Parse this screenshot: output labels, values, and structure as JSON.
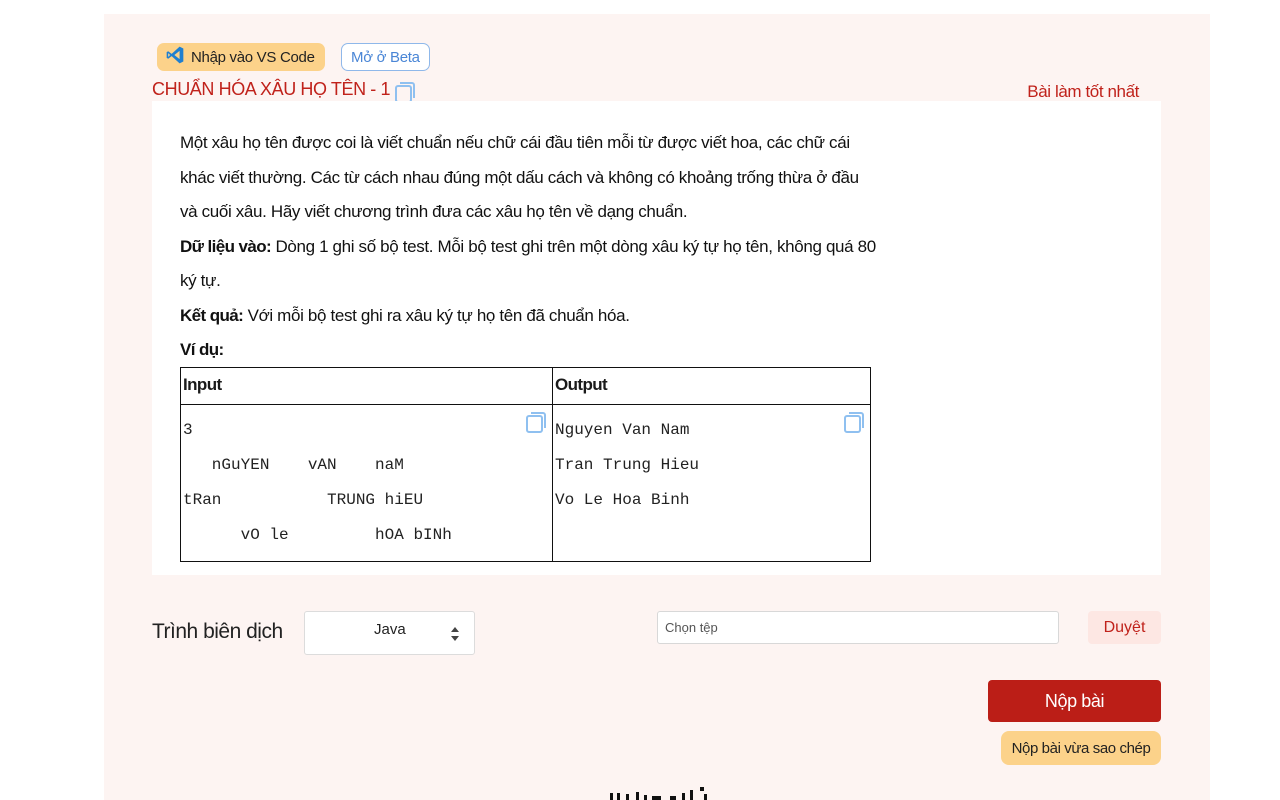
{
  "header": {
    "vscode_button": "Nhập vào VS Code",
    "beta_button": "Mở ở Beta",
    "title": "CHUẨN HÓA XÂU HỌ TÊN - 1",
    "best_submission": "Bài làm tốt nhất"
  },
  "problem": {
    "paragraph1": "Một xâu họ tên được coi là viết chuẩn nếu chữ cái đầu tiên mỗi từ được viết hoa, các chữ cái khác viết thường. Các từ cách nhau đúng một dấu cách và không có khoảng trống thừa ở đầu và cuối xâu. Hãy viết chương trình đưa các xâu họ tên về dạng chuẩn.",
    "input_label": "Dữ liệu vào:",
    "input_text": " Dòng 1 ghi số bộ test. Mỗi bộ test ghi trên một dòng xâu ký tự họ tên, không quá 80 ký tự.",
    "output_label": "Kết quả:",
    "output_text": " Với mỗi bộ test ghi ra xâu ký tự họ tên đã chuẩn hóa.",
    "example_label": "Ví dụ:"
  },
  "example": {
    "headers": [
      "Input",
      "Output"
    ],
    "input": "3\n   nGuYEN    vAN    naM\ntRan           TRUNG hiEU\n      vO le         hOA bINh",
    "output": "Nguyen Van Nam\nTran Trung Hieu\nVo Le Hoa Binh"
  },
  "submit": {
    "compiler_label": "Trình biên dịch",
    "compiler_value": "Java",
    "file_placeholder": "Chọn tệp",
    "browse_button": "Duyệt",
    "submit_button": "Nộp bài",
    "submit_copied_button": "Nộp bài vừa sao chép"
  },
  "colors": {
    "accent": "#bb1e17",
    "title_red": "#c0221b",
    "yellow": "#fcd28a",
    "background": "#fdf4f2",
    "copy_icon_blue": "#8fc0f0"
  },
  "icons": {
    "vscode": "vscode-icon",
    "copy": "copy-icon",
    "select_arrows": "sort-arrows-icon"
  }
}
